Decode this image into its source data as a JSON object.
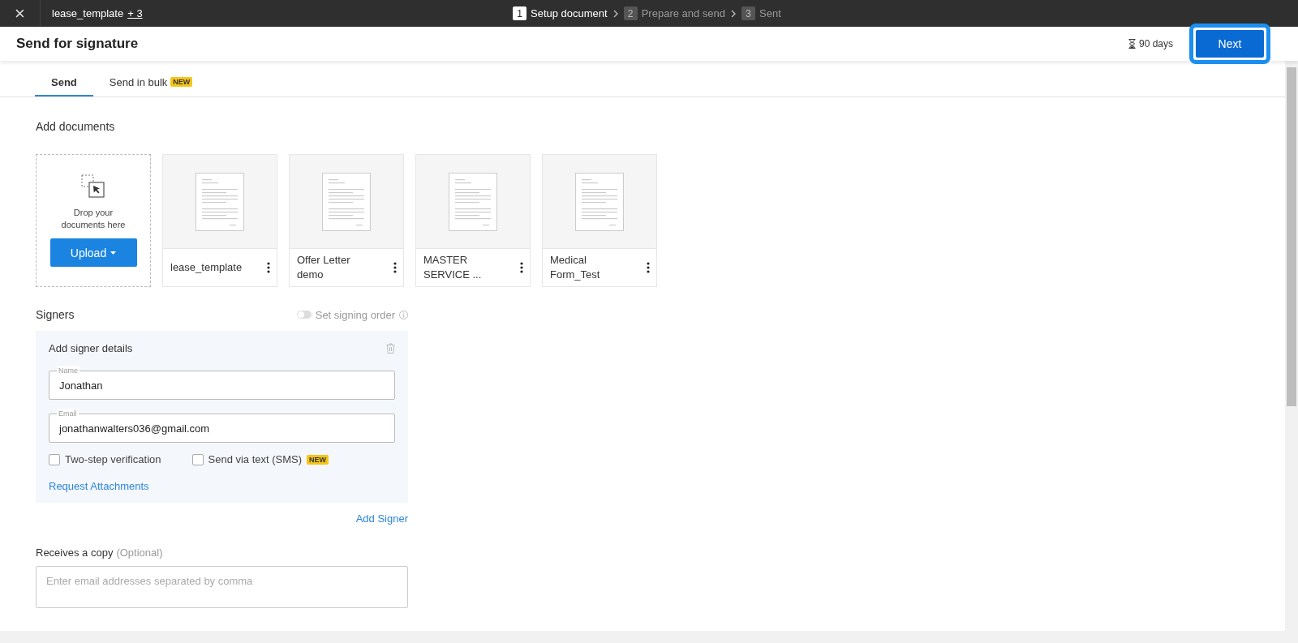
{
  "topbar": {
    "close": "×",
    "file_name": "lease_template",
    "extra_count": "+ 3",
    "steps": [
      {
        "number": "1",
        "label": "Setup document",
        "selected": true
      },
      {
        "number": "2",
        "label": "Prepare and send",
        "selected": false
      },
      {
        "number": "3",
        "label": "Sent",
        "selected": false
      }
    ]
  },
  "header": {
    "title": "Send for signature",
    "expiry": "90 days",
    "next_button": {
      "label": "Next",
      "highlighted": true
    }
  },
  "tabs": [
    {
      "label": "Send",
      "selected": true
    },
    {
      "label": "Send in bulk",
      "badge": "NEW",
      "selected": false
    }
  ],
  "documents": {
    "heading": "Add documents",
    "drop_text": "Drop your documents here",
    "upload_button": "Upload",
    "items": [
      {
        "name": "lease_template"
      },
      {
        "name": "Offer Letter demo"
      },
      {
        "name": "MASTER SERVICE ..."
      },
      {
        "name": "Medical Form_Test"
      }
    ]
  },
  "signers": {
    "heading": "Signers",
    "signing_order": {
      "label": "Set signing order",
      "on": false
    },
    "card": {
      "title": "Add signer details",
      "fields": [
        {
          "label": "Name",
          "value": "Jonathan"
        },
        {
          "label": "Email",
          "value": "jonathanwalters036@gmail.com"
        }
      ],
      "options": [
        {
          "label": "Two-step verification",
          "checked": false
        },
        {
          "label": "Send via text (SMS)",
          "badge": "NEW",
          "checked": false
        }
      ],
      "link": "Request Attachments"
    },
    "add_signer": "Add Signer"
  },
  "copy": {
    "heading": "Receives a copy",
    "hint": "(Optional)",
    "placeholder": "Enter email addresses separated by comma"
  }
}
